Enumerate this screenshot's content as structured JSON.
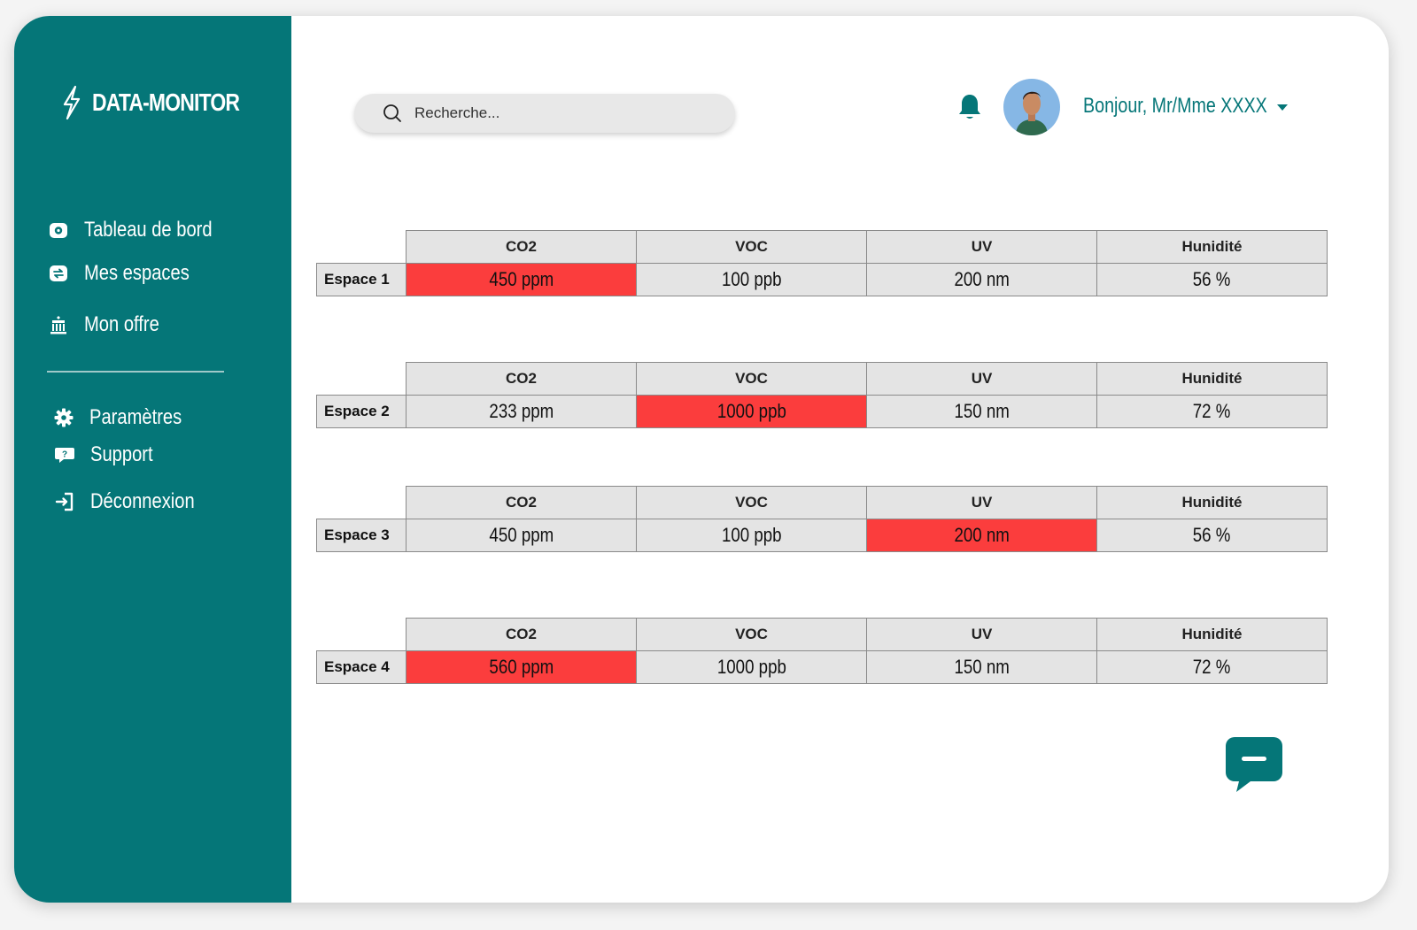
{
  "brand": {
    "name": "DATA-MONITOR",
    "icon": "lightning-icon"
  },
  "sidebar": {
    "items": [
      {
        "label": "Tableau de bord",
        "icon": "dashboard-icon"
      },
      {
        "label": "Mes espaces",
        "icon": "spaces-icon"
      },
      {
        "label": "Mon offre",
        "icon": "building-icon"
      }
    ],
    "secondary": [
      {
        "label": "Paramètres",
        "icon": "gear-icon"
      },
      {
        "label": "Support",
        "icon": "help-chat-icon"
      },
      {
        "label": "Déconnexion",
        "icon": "logout-icon"
      }
    ]
  },
  "header": {
    "search_placeholder": "Recherche...",
    "greeting": "Bonjour, Mr/Mme XXXX",
    "notification_icon": "bell-icon",
    "avatar_icon": "user-avatar"
  },
  "columns": [
    "CO2",
    "VOC",
    "UV",
    "Hunidité"
  ],
  "espaces": [
    {
      "name": "Espace 1",
      "values": [
        "450 ppm",
        "100 ppb",
        "200 nm",
        "56 %"
      ],
      "alerts": [
        true,
        false,
        false,
        false
      ]
    },
    {
      "name": "Espace 2",
      "values": [
        "233 ppm",
        "1000 ppb",
        "150 nm",
        "72 %"
      ],
      "alerts": [
        false,
        true,
        false,
        false
      ]
    },
    {
      "name": "Espace 3",
      "values": [
        "450 ppm",
        "100 ppb",
        "200 nm",
        "56 %"
      ],
      "alerts": [
        false,
        false,
        true,
        false
      ]
    },
    {
      "name": "Espace 4",
      "values": [
        "560 ppm",
        "1000 ppb",
        "150 nm",
        "72 %"
      ],
      "alerts": [
        true,
        false,
        false,
        false
      ]
    }
  ],
  "colors": {
    "sidebar": "#057678",
    "alert": "#fb3d3d",
    "cell": "#e4e4e4",
    "accent": "#057678"
  },
  "chat_button_icon": "chat-bubble-icon"
}
